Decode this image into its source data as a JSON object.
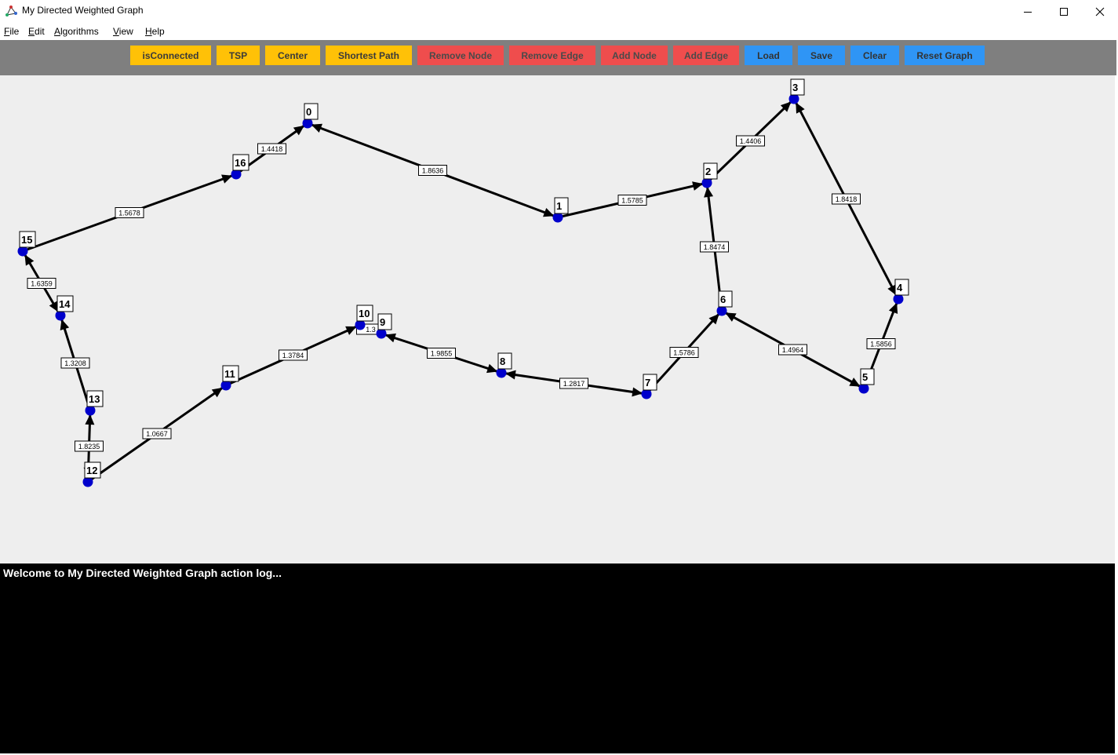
{
  "window": {
    "title": "My Directed Weighted Graph",
    "controls": [
      "minimize",
      "maximize",
      "close"
    ]
  },
  "menu": [
    "File",
    "Edit",
    "Algorithms",
    "View",
    "Help"
  ],
  "toolbar": {
    "buttons": [
      {
        "label": "isConnected",
        "color": "#ffc107"
      },
      {
        "label": "TSP",
        "color": "#ffc107"
      },
      {
        "label": "Center",
        "color": "#ffc107"
      },
      {
        "label": "Shortest Path",
        "color": "#ffc107"
      },
      {
        "label": "Remove Node",
        "color": "#ef4d4d"
      },
      {
        "label": "Remove Edge",
        "color": "#ef4d4d"
      },
      {
        "label": "Add Node",
        "color": "#ef4d4d"
      },
      {
        "label": "Add Edge",
        "color": "#ef4d4d"
      },
      {
        "label": "Load",
        "color": "#2f95f5"
      },
      {
        "label": "Save",
        "color": "#2f95f5"
      },
      {
        "label": "Clear",
        "color": "#2f95f5"
      },
      {
        "label": "Reset Graph",
        "color": "#2f95f5"
      }
    ]
  },
  "graph": {
    "node_color": "#0000cc",
    "edge_color": "#000000",
    "nodes": [
      "0",
      "1",
      "2",
      "3",
      "4",
      "5",
      "6",
      "7",
      "8",
      "9",
      "10",
      "11",
      "12",
      "13",
      "14",
      "15",
      "16"
    ],
    "edges": [
      {
        "from": "1",
        "to": "0",
        "weight": "1.8636",
        "bidirectional": true
      },
      {
        "from": "16",
        "to": "0",
        "weight": "1.4418",
        "bidirectional": false
      },
      {
        "from": "15",
        "to": "16",
        "weight": "1.5678",
        "bidirectional": false
      },
      {
        "from": "1",
        "to": "2",
        "weight": "1.5785",
        "bidirectional": false
      },
      {
        "from": "2",
        "to": "3",
        "weight": "1.4406",
        "bidirectional": false
      },
      {
        "from": "3",
        "to": "4",
        "weight": "1.8418",
        "bidirectional": true
      },
      {
        "from": "6",
        "to": "2",
        "weight": "1.8474",
        "bidirectional": false
      },
      {
        "from": "5",
        "to": "4",
        "weight": "1.5856",
        "bidirectional": false
      },
      {
        "from": "6",
        "to": "5",
        "weight": "1.4964",
        "bidirectional": true
      },
      {
        "from": "7",
        "to": "6",
        "weight": "1.5786",
        "bidirectional": false
      },
      {
        "from": "8",
        "to": "7",
        "weight": "1.2817",
        "bidirectional": true
      },
      {
        "from": "9",
        "to": "8",
        "weight": "1.9855",
        "bidirectional": true
      },
      {
        "from": "11",
        "to": "10",
        "weight": "1.3784",
        "bidirectional": false
      },
      {
        "from": "12",
        "to": "11",
        "weight": "1.0667",
        "bidirectional": false
      },
      {
        "from": "12",
        "to": "13",
        "weight": "1.8235",
        "bidirectional": true
      },
      {
        "from": "13",
        "to": "14",
        "weight": "1.3208",
        "bidirectional": false
      },
      {
        "from": "14",
        "to": "15",
        "weight": "1.6359",
        "bidirectional": true
      },
      {
        "from": "10",
        "to": "9",
        "weight": "1.3",
        "bidirectional": false
      }
    ]
  },
  "log": {
    "text": "Welcome to My Directed Weighted Graph action log..."
  }
}
